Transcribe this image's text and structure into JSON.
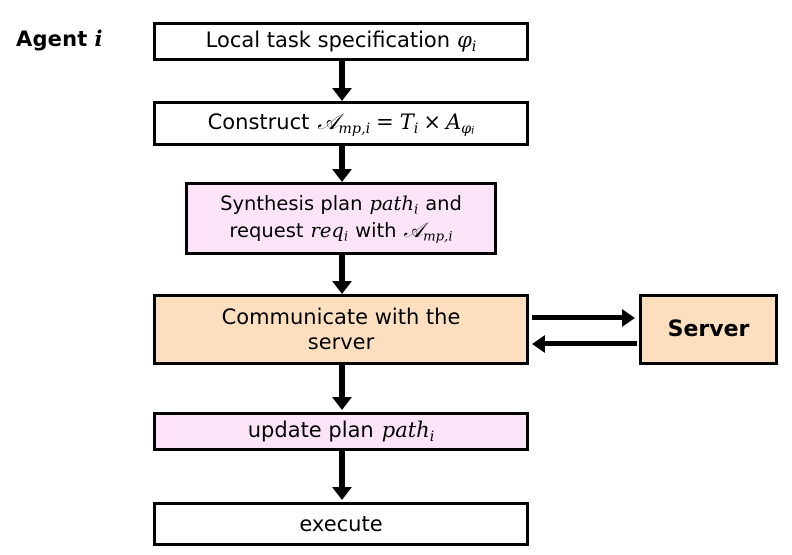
{
  "diagram": {
    "agent_label": {
      "prefix": "Agent",
      "variable": "i"
    },
    "nodes": {
      "local_task_spec": {
        "text_prefix": "Local task specification",
        "symbol": "φ",
        "symbol_subscript": "i",
        "fill": "#ffffff"
      },
      "construct": {
        "text_prefix": "Construct",
        "lhs": "𝒜",
        "lhs_subscript": "mp,i",
        "equals": "=",
        "rhs_first": "T",
        "rhs_first_subscript": "i",
        "times": "×",
        "rhs_second": "A",
        "rhs_second_subscript_symbol": "φ",
        "rhs_second_subscript_index": "i",
        "fill": "#ffffff"
      },
      "synthesis": {
        "line1_prefix": "Synthesis plan",
        "line1_symbol": "path",
        "line1_subscript": "i",
        "line1_suffix": "and",
        "line2_prefix": "request",
        "line2_symbol": "req",
        "line2_subscript": "i",
        "line2_mid": "with",
        "line2_symbol2": "𝒜",
        "line2_subscript2": "mp,i",
        "fill": "#fbe4f7"
      },
      "communicate": {
        "line1": "Communicate with the",
        "line2": "server",
        "fill": "#fbdfbe"
      },
      "server": {
        "label": "Server",
        "fill": "#fbdfbe"
      },
      "update_plan": {
        "text_prefix": "update plan",
        "symbol": "path",
        "symbol_subscript": "i",
        "fill": "#fbe4f7"
      },
      "execute": {
        "label": "execute",
        "fill": "#ffffff"
      }
    },
    "connectors": {
      "spec_to_construct": "arrow-down",
      "construct_to_synthesis": "arrow-down",
      "synthesis_to_communicate": "arrow-down",
      "communicate_to_update": "arrow-down",
      "update_to_execute": "arrow-down",
      "communicate_to_server": "arrow-right",
      "server_to_communicate": "arrow-left"
    },
    "colors": {
      "stroke": "#000000",
      "pink": "#fbe4f7",
      "orange": "#fbdfbe",
      "white": "#ffffff"
    }
  }
}
